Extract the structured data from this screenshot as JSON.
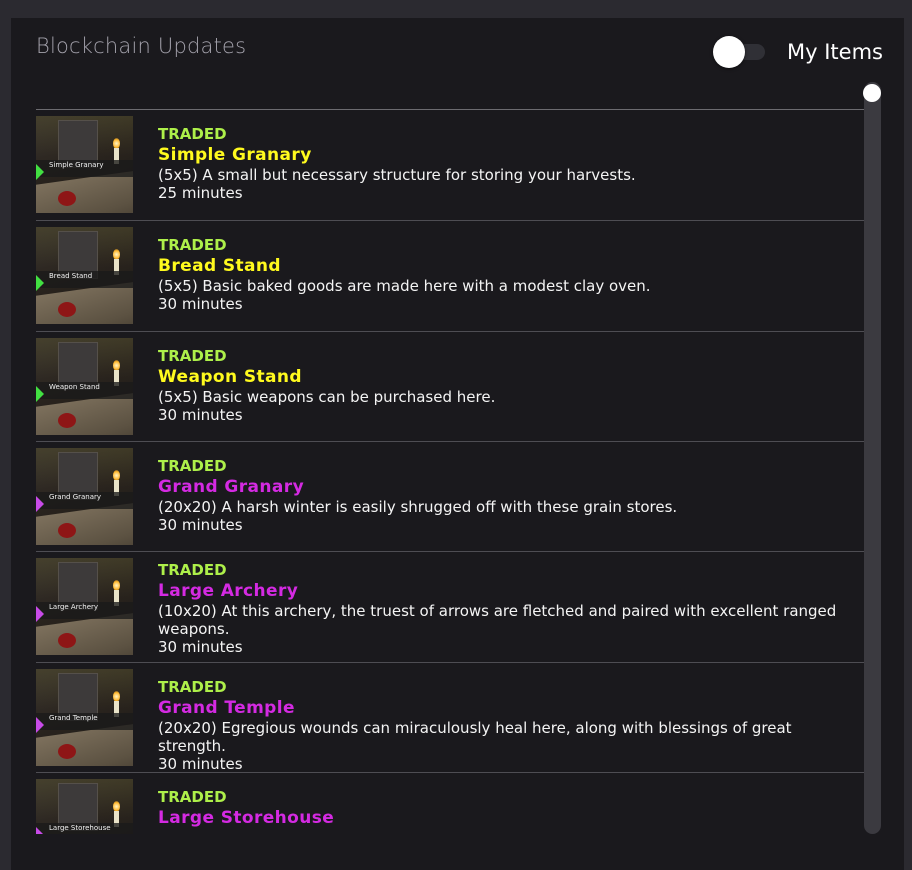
{
  "panel": {
    "title": "Blockchain Updates",
    "toggle_label": "My Items",
    "toggle_on": false
  },
  "colors": {
    "status": "#aef04a",
    "small": "#fffa1e",
    "large": "#d42ae2"
  },
  "items": [
    {
      "status": "TRADED",
      "name": "Simple Granary",
      "thumb_caption": "Simple Granary",
      "desc": "(5x5) A small but necessary structure for storing your harvests.",
      "time": "25 minutes",
      "tier": "small"
    },
    {
      "status": "TRADED",
      "name": "Bread Stand",
      "thumb_caption": "Bread Stand",
      "desc": "(5x5) Basic baked goods are made here with a modest clay oven.",
      "time": "30 minutes",
      "tier": "small"
    },
    {
      "status": "TRADED",
      "name": "Weapon Stand",
      "thumb_caption": "Weapon Stand",
      "desc": "(5x5) Basic weapons can be purchased here.",
      "time": "30 minutes",
      "tier": "small"
    },
    {
      "status": "TRADED",
      "name": "Grand Granary",
      "thumb_caption": "Grand Granary",
      "desc": "(20x20) A harsh winter is easily shrugged off with these grain stores.",
      "time": "30 minutes",
      "tier": "large"
    },
    {
      "status": "TRADED",
      "name": "Large Archery",
      "thumb_caption": "Large Archery",
      "desc": "(10x20) At this archery, the truest of arrows are fletched and paired with excellent ranged weapons.",
      "time": "30 minutes",
      "tier": "large"
    },
    {
      "status": "TRADED",
      "name": "Grand Temple",
      "thumb_caption": "Grand Temple",
      "desc": "(20x20) Egregious wounds can miraculously heal here, along with blessings of great strength.",
      "time": "30 minutes",
      "tier": "large"
    },
    {
      "status": "TRADED",
      "name": "Large Storehouse",
      "thumb_caption": "Large Storehouse",
      "desc": "",
      "time": "",
      "tier": "large"
    }
  ]
}
